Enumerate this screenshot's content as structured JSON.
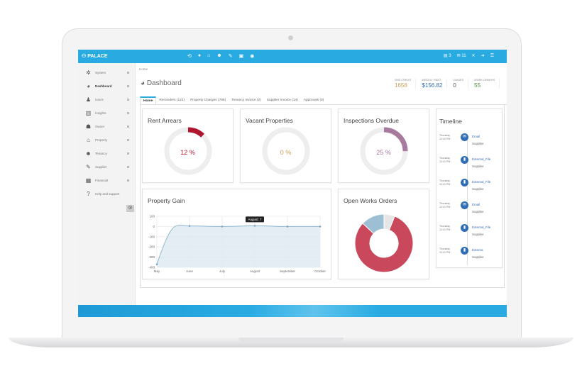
{
  "app": {
    "name": "PALACE"
  },
  "topbar": {
    "icons": [
      "refresh-icon",
      "user-icon",
      "home-icon",
      "users-icon",
      "wrench-icon",
      "lock-icon",
      "eye-icon"
    ],
    "docs_count": "3",
    "mail_count": "11"
  },
  "sidebar": {
    "items": [
      {
        "label": "System",
        "icon": "system-icon"
      },
      {
        "label": "Dashboard",
        "icon": "dashboard-icon",
        "active": true
      },
      {
        "label": "Users",
        "icon": "user-icon"
      },
      {
        "label": "Insights",
        "icon": "insights-icon"
      },
      {
        "label": "Owner",
        "icon": "owner-icon"
      },
      {
        "label": "Property",
        "icon": "home-icon"
      },
      {
        "label": "Tenancy",
        "icon": "users-icon"
      },
      {
        "label": "Supplier",
        "icon": "wrench-icon"
      },
      {
        "label": "Financial",
        "icon": "bank-icon"
      },
      {
        "label": "Help and support",
        "icon": "help-icon"
      }
    ]
  },
  "breadcrumb": "Home",
  "page_title": "Dashboard",
  "stats": [
    {
      "label": "SMS CREDIT",
      "value": "1658",
      "color": "#c8a25a"
    },
    {
      "label": "WEEKLY RENT",
      "value": "$156.82",
      "color": "#2f6db5"
    },
    {
      "label": "LEASES",
      "value": "0",
      "color": "#555"
    },
    {
      "label": "WORK ORDERS",
      "value": "55",
      "color": "#5a8a3a"
    }
  ],
  "tabs": [
    "Home",
    "Reminders (122)",
    "Property Charges (786)",
    "Tenancy Invoice (2)",
    "Supplier Invoice (14)",
    "Approvals (0)"
  ],
  "cards": [
    {
      "title": "Rent Arrears",
      "percent": 12,
      "label": "12 %",
      "color": "#b0172f"
    },
    {
      "title": "Vacant Properties",
      "percent": 0,
      "label": "0 %",
      "color": "#c8a25a"
    },
    {
      "title": "Inspections Overdue",
      "percent": 25,
      "label": "25 %",
      "color": "#a87a9e"
    }
  ],
  "timeline": {
    "title": "Timeline",
    "items": [
      {
        "day": "Thursday",
        "time": "12:42 PM",
        "name": "Email",
        "sub": "Supplier",
        "icon": "mail-icon"
      },
      {
        "day": "Thursday",
        "time": "12:41 PM",
        "name": "External_File",
        "sub": "Supplier",
        "icon": "file-icon"
      },
      {
        "day": "Thursday",
        "time": "12:41 PM",
        "name": "External_File",
        "sub": "Supplier",
        "icon": "file-icon"
      },
      {
        "day": "Thursday",
        "time": "12:41 PM",
        "name": "Email",
        "sub": "Supplier",
        "icon": "mail-icon"
      },
      {
        "day": "Thursday",
        "time": "12:41 PM",
        "name": "External_File",
        "sub": "Supplier",
        "icon": "file-icon"
      },
      {
        "day": "Thursday",
        "time": "12:41 PM",
        "name": "Externa",
        "sub": "Supplier",
        "icon": "file-icon"
      }
    ]
  },
  "chart_data": [
    {
      "type": "area",
      "title": "Property Gain",
      "categories": [
        "May",
        "June",
        "July",
        "August",
        "September",
        "October"
      ],
      "values": [
        -370,
        5,
        0,
        7,
        0,
        0
      ],
      "ylim": [
        -400,
        100
      ],
      "yticks": [
        100,
        0,
        -100,
        -200,
        -300,
        -400
      ],
      "grid": true,
      "tooltip": "August: 7",
      "color": "#8fb8d0"
    },
    {
      "type": "pie",
      "title": "Open Works Orders",
      "donut": true,
      "values": [
        81,
        13,
        6
      ],
      "colors": [
        "#c9485b",
        "#9dbfd3",
        "#e6e6e6"
      ]
    }
  ]
}
